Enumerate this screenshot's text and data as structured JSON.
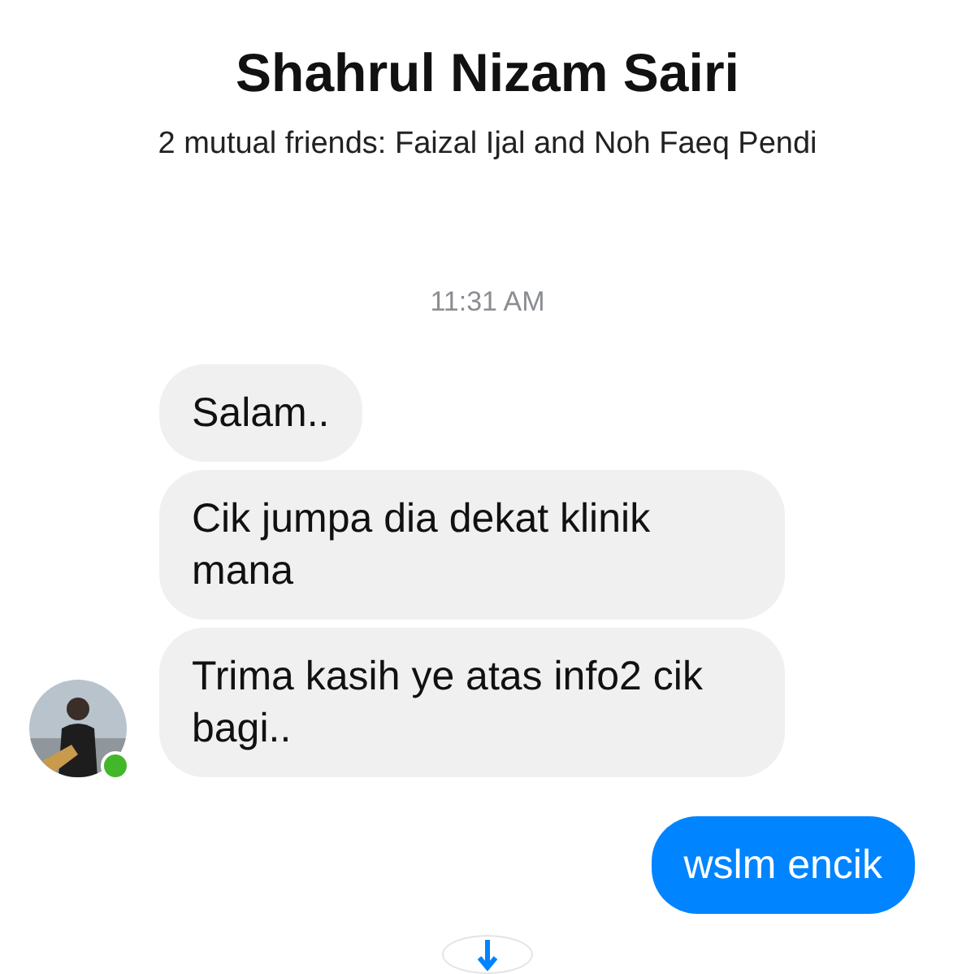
{
  "contact": {
    "name": "Shahrul Nizam Sairi",
    "mutual_friends": "2 mutual friends: Faizal Ijal and Noh Faeq Pendi",
    "online": true
  },
  "timestamp": "11:31 AM",
  "messages": [
    {
      "kind": "received",
      "text": "Salam.."
    },
    {
      "kind": "received",
      "text": "Cik jumpa dia dekat klinik mana"
    },
    {
      "kind": "received",
      "text": "Trima kasih ye atas info2 cik bagi.."
    },
    {
      "kind": "sent",
      "text": "wslm encik"
    }
  ]
}
